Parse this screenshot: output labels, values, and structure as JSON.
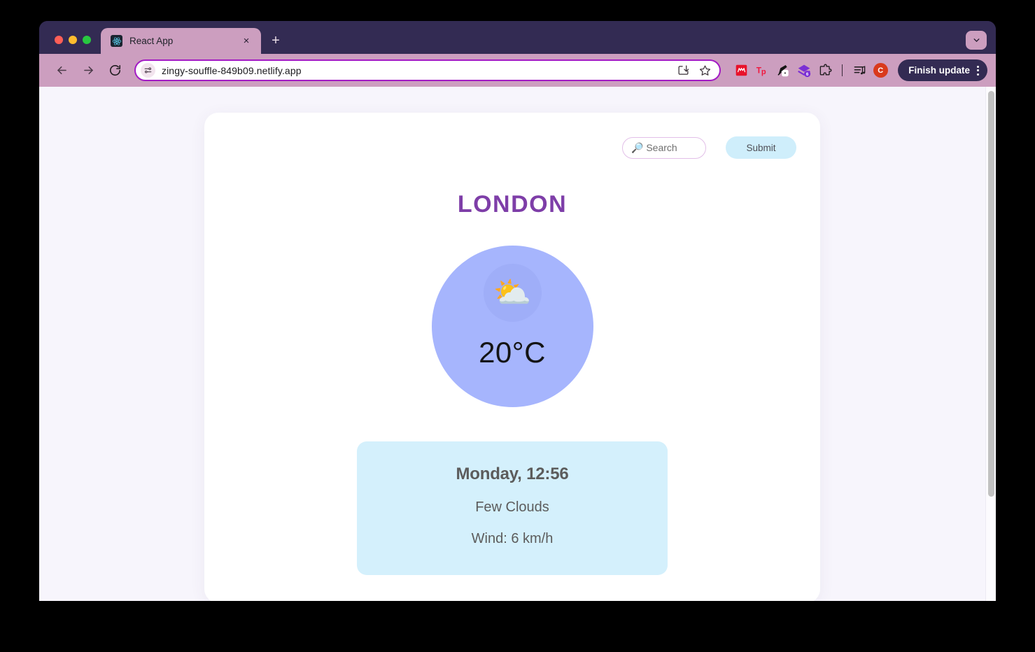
{
  "browser": {
    "traffic_lights": [
      "close",
      "minimize",
      "maximize"
    ],
    "tab": {
      "title": "React App",
      "favicon": "react-logo",
      "close_label": "×"
    },
    "new_tab_label": "+",
    "tabstrip_expander": "chevron-down",
    "nav": {
      "back": "back-arrow",
      "forward": "forward-arrow",
      "reload": "reload-arrow"
    },
    "omnibox": {
      "site_info_icon": "tune-sliders-icon",
      "url": "zingy-souffle-849b09.netlify.app",
      "install_icon": "install-app-icon",
      "bookmark_icon": "star-icon"
    },
    "extensions": [
      {
        "name": "momentum-extension",
        "badge": ""
      },
      {
        "name": "tp-extension",
        "badge": ""
      },
      {
        "name": "pen-pointer-extension",
        "badge": ""
      },
      {
        "name": "layers-extension",
        "badge": "6"
      },
      {
        "name": "puzzle-extensions-icon",
        "badge": ""
      }
    ],
    "media_icon": "playlist-music-icon",
    "profile": {
      "initial": "C",
      "color": "#D93A1C"
    },
    "finish_update": {
      "label": "Finish update",
      "menu_icon": "kebab-menu-icon"
    }
  },
  "app": {
    "search": {
      "placeholder": "🔎 Search",
      "value": ""
    },
    "submit_label": "Submit",
    "city": "LONDON",
    "weather": {
      "icon": "⛅",
      "icon_name": "sun-behind-cloud-icon",
      "temperature": "20°C"
    },
    "details": {
      "datetime": "Monday, 12:56",
      "description": "Few Clouds",
      "wind": "Wind: 6 km/h"
    },
    "colors": {
      "orb": "#A6B5FD",
      "orb_inner": "#9FAEF8",
      "info_card": "#D4F0FC",
      "city_text": "#7E3EA8",
      "submit_bg": "#CFEEFB",
      "page_bg": "#F7F5FC"
    }
  }
}
